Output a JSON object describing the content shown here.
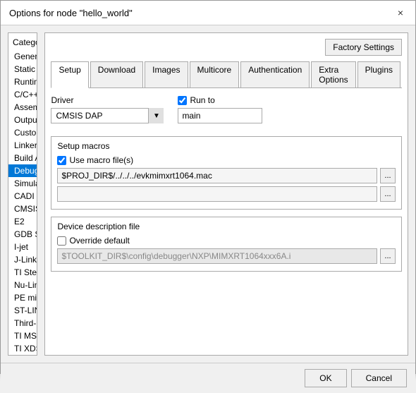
{
  "dialog": {
    "title": "Options for node \"hello_world\"",
    "close_label": "×"
  },
  "sidebar": {
    "category_label": "Category:",
    "items": [
      {
        "label": "General Options",
        "selected": false
      },
      {
        "label": "Static Analysis",
        "selected": false
      },
      {
        "label": "Runtime Checking",
        "selected": false
      },
      {
        "label": "C/C++ Compiler",
        "selected": false
      },
      {
        "label": "Assembler",
        "selected": false
      },
      {
        "label": "Output Converter",
        "selected": false
      },
      {
        "label": "Custom Build",
        "selected": false
      },
      {
        "label": "Linker",
        "selected": false
      },
      {
        "label": "Build Actions",
        "selected": false
      },
      {
        "label": "Debugger",
        "selected": true
      },
      {
        "label": "Simulator",
        "selected": false
      },
      {
        "label": "CADI",
        "selected": false
      },
      {
        "label": "CMSIS DAP",
        "selected": false
      },
      {
        "label": "E2",
        "selected": false
      },
      {
        "label": "GDB Server",
        "selected": false
      },
      {
        "label": "I-jet",
        "selected": false
      },
      {
        "label": "J-Link/J-Trace",
        "selected": false
      },
      {
        "label": "TI Stellaris",
        "selected": false
      },
      {
        "label": "Nu-Link",
        "selected": false
      },
      {
        "label": "PE micro",
        "selected": false
      },
      {
        "label": "ST-LINK",
        "selected": false
      },
      {
        "label": "Third-Party Driver",
        "selected": false
      },
      {
        "label": "TI MSP-FET",
        "selected": false
      },
      {
        "label": "TI XDS",
        "selected": false
      }
    ]
  },
  "main": {
    "factory_settings_label": "Factory Settings",
    "tabs": [
      {
        "label": "Setup",
        "active": true
      },
      {
        "label": "Download",
        "active": false
      },
      {
        "label": "Images",
        "active": false
      },
      {
        "label": "Multicore",
        "active": false
      },
      {
        "label": "Authentication",
        "active": false
      },
      {
        "label": "Extra Options",
        "active": false
      },
      {
        "label": "Plugins",
        "active": false
      }
    ],
    "driver_label": "Driver",
    "driver_value": "CMSIS DAP",
    "run_to_label": "Run to",
    "run_to_checked": true,
    "run_to_value": "main",
    "setup_macros_label": "Setup macros",
    "use_macro_label": "Use macro file(s)",
    "use_macro_checked": true,
    "macro_path": "$PROJ_DIR$/../../../evkmimxrt1064.mac",
    "macro_btn_label": "...",
    "macro_input2": "",
    "macro_btn2_label": "...",
    "device_desc_label": "Device description file",
    "override_label": "Override default",
    "override_checked": false,
    "device_path": "$TOOLKIT_DIR$\\config\\debugger\\NXP\\MIMXRT1064xxx6A.i",
    "device_btn_label": "..."
  },
  "footer": {
    "ok_label": "OK",
    "cancel_label": "Cancel"
  }
}
